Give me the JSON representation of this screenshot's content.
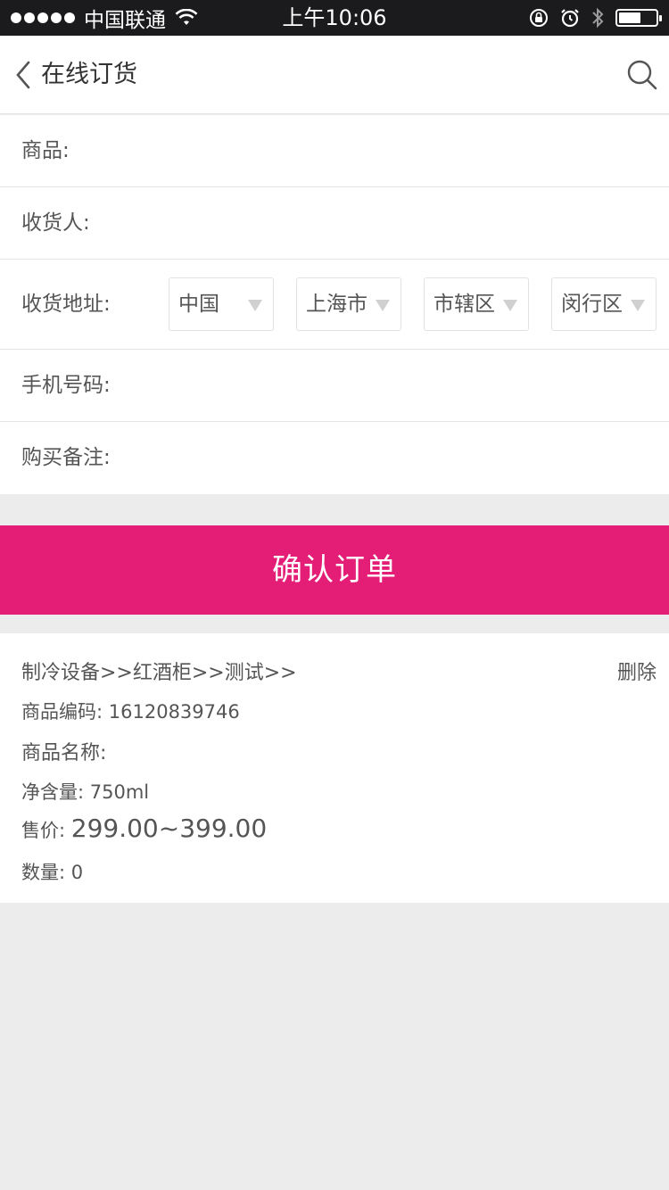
{
  "status_bar": {
    "carrier": "中国联通",
    "time": "上午10:06",
    "battery_level": 0.6
  },
  "nav": {
    "title": "在线订货",
    "back_icon": "chevron-left-icon",
    "search_icon": "search-icon"
  },
  "form": {
    "product_label": "商品:",
    "receiver_label": "收货人:",
    "address_label": "收货地址:",
    "address_selects": [
      {
        "value": "中国"
      },
      {
        "value": "上海市"
      },
      {
        "value": "市辖区"
      },
      {
        "value": "闵行区"
      }
    ],
    "phone_label": "手机号码:",
    "note_label": "购买备注:"
  },
  "confirm_label": "确认订单",
  "product": {
    "category_path": "制冷设备>>红酒柜>>测试>>",
    "delete_label": "删除",
    "code_label": "商品编码:",
    "code_value": "16120839746",
    "name_label": "商品名称:",
    "name_value": "",
    "volume_label": "净含量:",
    "volume_value": "750ml",
    "price_label": "售价:",
    "price_value": "299.00~399.00",
    "qty_label": "数量:",
    "qty_value": "0"
  },
  "colors": {
    "accent": "#e41e77",
    "status_bar_bg": "#1b1b1d",
    "page_bg": "#ececec"
  }
}
